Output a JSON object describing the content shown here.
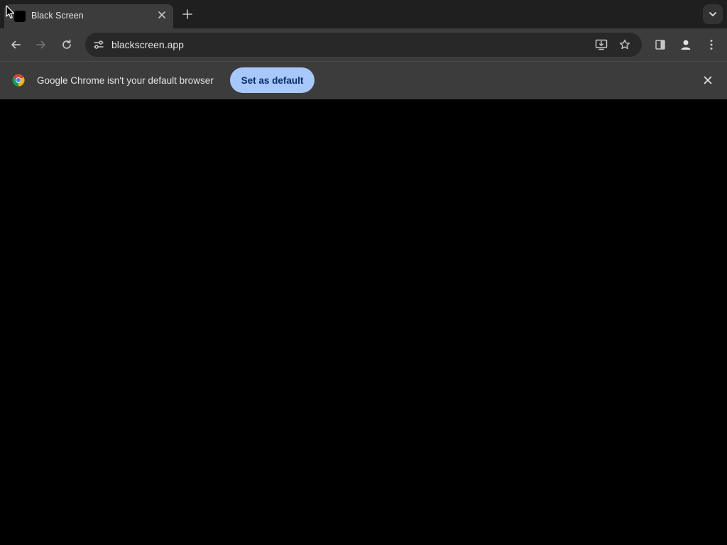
{
  "tab": {
    "title": "Black Screen",
    "favicon": "black-square-icon",
    "close_icon": "close-icon"
  },
  "new_tab_icon": "plus-icon",
  "tab_search_icon": "chevron-down-icon",
  "toolbar": {
    "back_icon": "arrow-left-icon",
    "forward_icon": "arrow-right-icon",
    "reload_icon": "reload-icon",
    "site_info_icon": "tune-icon",
    "url": "blackscreen.app",
    "install_icon": "install-app-icon",
    "bookmark_icon": "star-icon",
    "side_panel_icon": "side-panel-icon",
    "profile_icon": "profile-icon",
    "menu_icon": "kebab-menu-icon"
  },
  "infobar": {
    "logo": "chrome-logo-icon",
    "message": "Google Chrome isn't your default browser",
    "button_label": "Set as default",
    "close_icon": "close-icon"
  },
  "colors": {
    "page_background": "#000000",
    "toolbar": "#3c3c3c",
    "tabstrip": "#1f1f1f",
    "accent_button": "#a8c7fa",
    "accent_button_text": "#062e6f"
  }
}
